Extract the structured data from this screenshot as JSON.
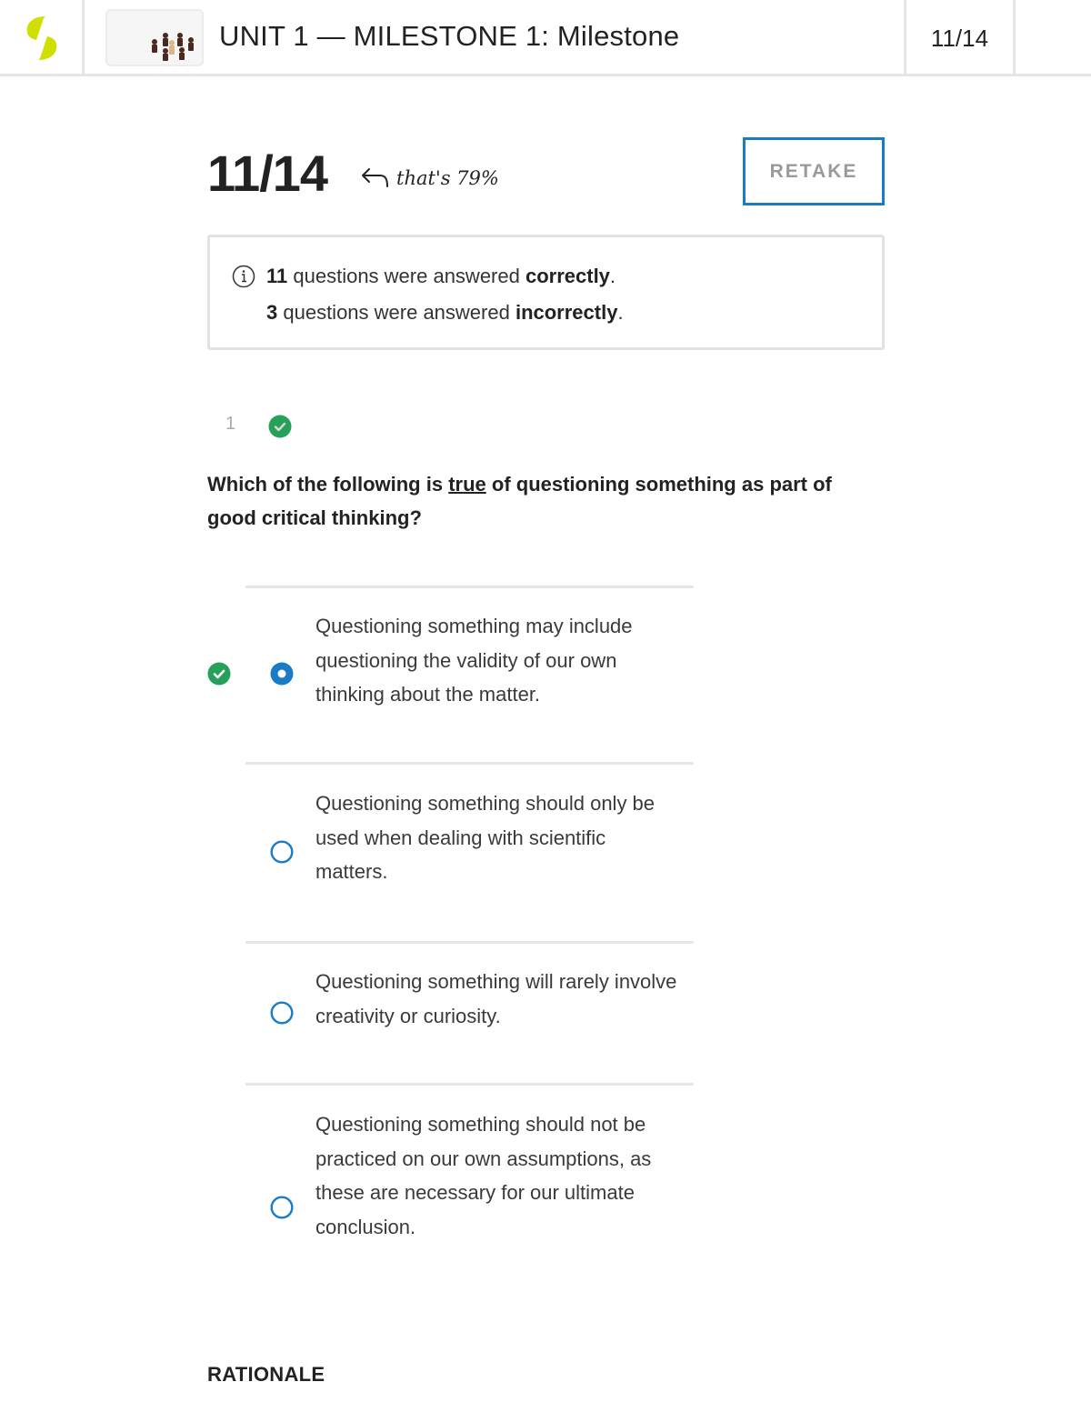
{
  "header": {
    "logo_icon": "sophia-logo-icon",
    "thumbnail_icon": "chess-pieces-thumbnail",
    "title": "UNIT 1 — MILESTONE 1: Milestone",
    "score": "11/14"
  },
  "result": {
    "score": "11/14",
    "note_arrow_icon": "curved-arrow-left-icon",
    "note": "that's 79%",
    "percent": 79,
    "retake_label": "RETAKE"
  },
  "summary": {
    "icon": "info-icon",
    "correct_count": "11",
    "correct_text": " questions were answered ",
    "correct_word": "correctly",
    "incorrect_count": "3",
    "incorrect_text": " questions were answered ",
    "incorrect_word": "incorrectly",
    "period": "."
  },
  "question": {
    "number": "1",
    "status": "correct",
    "text_before": "Which of the following is ",
    "text_emphasis": "true",
    "text_after": " of questioning something as part of good critical thinking?",
    "options": [
      {
        "text": "Questioning something may include questioning the validity of our own thinking about the matter.",
        "selected": true,
        "correct": true
      },
      {
        "text": "Questioning something should only be used when dealing with scientific matters.",
        "selected": false,
        "correct": false
      },
      {
        "text": "Questioning something will rarely involve creativity or curiosity.",
        "selected": false,
        "correct": false
      },
      {
        "text": "Questioning something should not be practiced on our own assumptions, as these are necessary for our ultimate conclusion.",
        "selected": false,
        "correct": false
      }
    ]
  },
  "rationale_label": "RATIONALE",
  "colors": {
    "accent_blue": "#1a7bc6",
    "correct_green": "#27a05a",
    "logo_lime": "#cfdf00",
    "border_gray": "#e6e6e6"
  }
}
